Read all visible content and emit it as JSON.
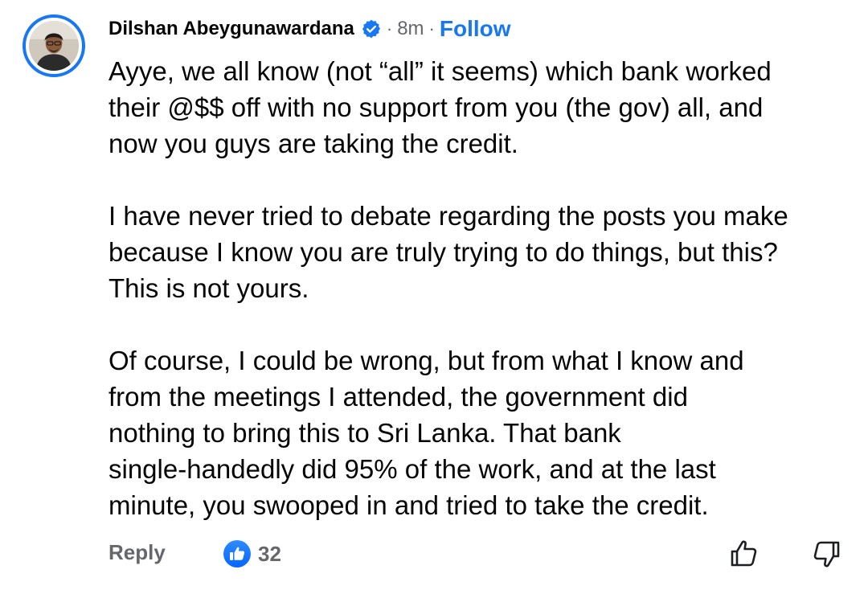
{
  "comment": {
    "author": "Dilshan Abeygunawardana",
    "separator": "·",
    "time": "8m",
    "follow_label": "Follow",
    "paragraphs": [
      {
        "lines": [
          "Ayye, we all know (not “all” it seems) which bank worked",
          "their @$$ off with no support from you (the gov) all, and",
          "now you guys are taking the credit."
        ]
      },
      {
        "lines": [
          "I have never tried to debate regarding the posts you make",
          "because I know you are truly trying to do things, but this?",
          "This is not yours."
        ]
      },
      {
        "lines": [
          "Of course, I could be wrong, but from what I know and",
          "from the meetings I attended, the government did",
          "nothing to bring this to Sri Lanka. That bank",
          "single-handedly did 95% of the work, and at the last",
          "minute, you swooped in and tried to take the credit."
        ]
      }
    ],
    "reply_label": "Reply",
    "reaction_count": "32",
    "icons": {
      "verified": "verified-badge-icon",
      "like": "like-reaction-icon",
      "upvote": "thumbs-up-outline-icon",
      "downvote": "thumbs-down-outline-icon"
    }
  },
  "colors": {
    "accent": "#1877f2",
    "secondary_text": "#65676b",
    "primary_text": "#050505"
  }
}
